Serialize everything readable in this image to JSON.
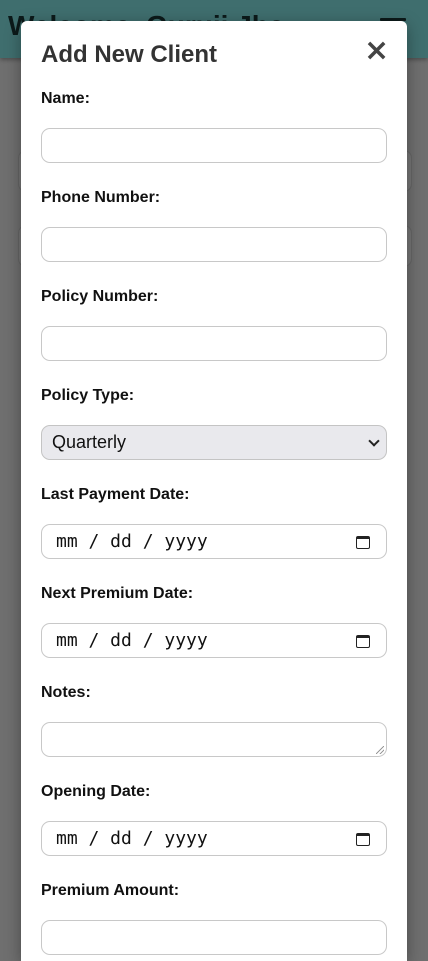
{
  "background": {
    "app_title": "Welcome, Guruji Jha"
  },
  "modal": {
    "title": "Add New Client",
    "close_label": "×",
    "fields": {
      "name": {
        "label": "Name:",
        "value": ""
      },
      "phone": {
        "label": "Phone Number:",
        "value": ""
      },
      "policy_number": {
        "label": "Policy Number:",
        "value": ""
      },
      "policy_type": {
        "label": "Policy Type:",
        "selected": "Quarterly"
      },
      "last_payment": {
        "label": "Last Payment Date:",
        "placeholder": "mm / dd / yyyy"
      },
      "next_premium": {
        "label": "Next Premium Date:",
        "placeholder": "mm / dd / yyyy"
      },
      "notes": {
        "label": "Notes:",
        "value": ""
      },
      "opening_date": {
        "label": "Opening Date:",
        "placeholder": "mm / dd / yyyy"
      },
      "premium_amount": {
        "label": "Premium Amount:",
        "value": ""
      }
    }
  },
  "icons": {
    "close": "close-icon",
    "calendar": "calendar-icon",
    "menu": "hamburger-menu-icon",
    "dropdown": "chevron-down-icon"
  }
}
